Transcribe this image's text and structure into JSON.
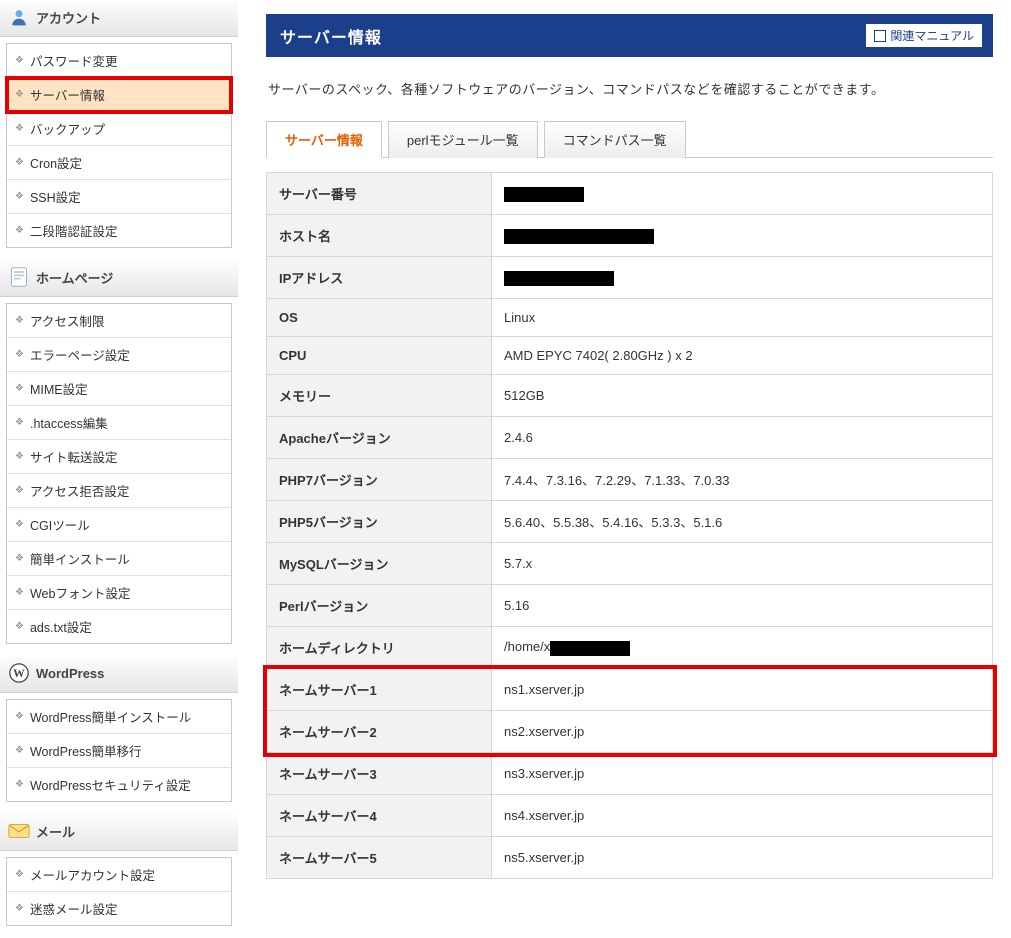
{
  "sidebar": {
    "sections": [
      {
        "title": "アカウント",
        "icon": "user",
        "items": [
          {
            "label": "パスワード変更",
            "active": false,
            "highlight": false
          },
          {
            "label": "サーバー情報",
            "active": true,
            "highlight": true
          },
          {
            "label": "バックアップ",
            "active": false,
            "highlight": false
          },
          {
            "label": "Cron設定",
            "active": false,
            "highlight": false
          },
          {
            "label": "SSH設定",
            "active": false,
            "highlight": false
          },
          {
            "label": "二段階認証設定",
            "active": false,
            "highlight": false
          }
        ]
      },
      {
        "title": "ホームページ",
        "icon": "page",
        "items": [
          {
            "label": "アクセス制限",
            "active": false,
            "highlight": false
          },
          {
            "label": "エラーページ設定",
            "active": false,
            "highlight": false
          },
          {
            "label": "MIME設定",
            "active": false,
            "highlight": false
          },
          {
            "label": ".htaccess編集",
            "active": false,
            "highlight": false
          },
          {
            "label": "サイト転送設定",
            "active": false,
            "highlight": false
          },
          {
            "label": "アクセス拒否設定",
            "active": false,
            "highlight": false
          },
          {
            "label": "CGIツール",
            "active": false,
            "highlight": false
          },
          {
            "label": "簡単インストール",
            "active": false,
            "highlight": false
          },
          {
            "label": "Webフォント設定",
            "active": false,
            "highlight": false
          },
          {
            "label": "ads.txt設定",
            "active": false,
            "highlight": false
          }
        ]
      },
      {
        "title": "WordPress",
        "icon": "wp",
        "items": [
          {
            "label": "WordPress簡単インストール",
            "active": false,
            "highlight": false
          },
          {
            "label": "WordPress簡単移行",
            "active": false,
            "highlight": false
          },
          {
            "label": "WordPressセキュリティ設定",
            "active": false,
            "highlight": false
          }
        ]
      },
      {
        "title": "メール",
        "icon": "mail",
        "items": [
          {
            "label": "メールアカウント設定",
            "active": false,
            "highlight": false
          },
          {
            "label": "迷惑メール設定",
            "active": false,
            "highlight": false
          }
        ]
      }
    ]
  },
  "main": {
    "page_title": "サーバー情報",
    "manual_button": "関連マニュアル",
    "description": "サーバーのスペック、各種ソフトウェアのバージョン、コマンドパスなどを確認することができます。",
    "tabs": [
      {
        "label": "サーバー情報",
        "active": true
      },
      {
        "label": "perlモジュール一覧",
        "active": false
      },
      {
        "label": "コマンドパス一覧",
        "active": false
      }
    ],
    "rows": [
      {
        "label": "サーバー番号",
        "value": "",
        "redact_width": 80,
        "highlight": false
      },
      {
        "label": "ホスト名",
        "value": "",
        "redact_width": 150,
        "highlight": false
      },
      {
        "label": "IPアドレス",
        "value": "",
        "redact_width": 110,
        "highlight": false
      },
      {
        "label": "OS",
        "value": "Linux",
        "redact_width": 0,
        "highlight": false
      },
      {
        "label": "CPU",
        "value": "AMD EPYC 7402( 2.80GHz ) x 2",
        "redact_width": 0,
        "highlight": false
      },
      {
        "label": "メモリー",
        "value": "512GB",
        "redact_width": 0,
        "highlight": false
      },
      {
        "label": "Apacheバージョン",
        "value": "2.4.6",
        "redact_width": 0,
        "highlight": false
      },
      {
        "label": "PHP7バージョン",
        "value": "7.4.4、7.3.16、7.2.29、7.1.33、7.0.33",
        "redact_width": 0,
        "highlight": false
      },
      {
        "label": "PHP5バージョン",
        "value": "5.6.40、5.5.38、5.4.16、5.3.3、5.1.6",
        "redact_width": 0,
        "highlight": false
      },
      {
        "label": "MySQLバージョン",
        "value": "5.7.x",
        "redact_width": 0,
        "highlight": false
      },
      {
        "label": "Perlバージョン",
        "value": "5.16",
        "redact_width": 0,
        "highlight": false
      },
      {
        "label": "ホームディレクトリ",
        "value": "/home/x",
        "redact_width": 80,
        "highlight": false
      },
      {
        "label": "ネームサーバー1",
        "value": "ns1.xserver.jp",
        "redact_width": 0,
        "highlight": true
      },
      {
        "label": "ネームサーバー2",
        "value": "ns2.xserver.jp",
        "redact_width": 0,
        "highlight": true
      },
      {
        "label": "ネームサーバー3",
        "value": "ns3.xserver.jp",
        "redact_width": 0,
        "highlight": false
      },
      {
        "label": "ネームサーバー4",
        "value": "ns4.xserver.jp",
        "redact_width": 0,
        "highlight": false
      },
      {
        "label": "ネームサーバー5",
        "value": "ns5.xserver.jp",
        "redact_width": 0,
        "highlight": false
      }
    ]
  }
}
